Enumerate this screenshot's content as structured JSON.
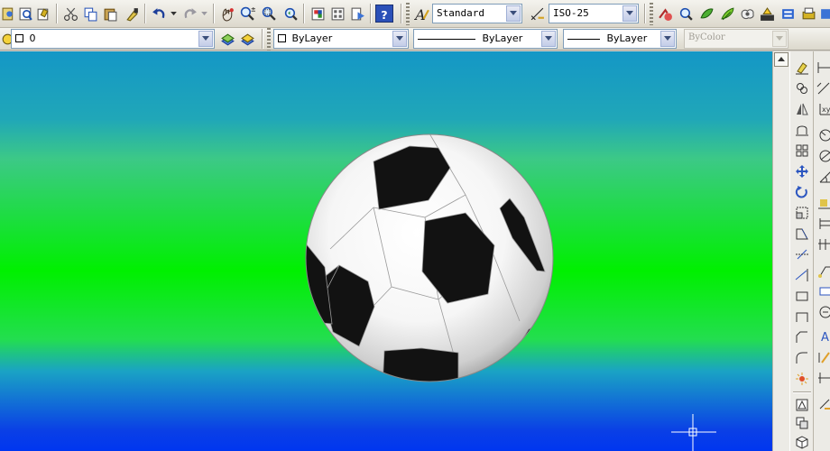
{
  "toolbar": {
    "text_style": {
      "value": "Standard"
    },
    "dim_style": {
      "value": "ISO-25"
    },
    "icons": [
      "design-center-icon",
      "tool-palettes-icon",
      "sheet-set-icon",
      "cut-icon",
      "copy-icon",
      "paste-icon",
      "match-properties-icon",
      "undo-icon",
      "undo-dropdown-icon",
      "redo-icon",
      "redo-dropdown-icon",
      "pan-icon",
      "zoom-realtime-icon",
      "zoom-window-icon",
      "zoom-previous-icon",
      "properties-icon",
      "design-center-2-icon",
      "tool-palettes-2-icon",
      "help-icon",
      "text-style-icon",
      "dim-style-icon",
      "render-lights-icon",
      "render-scene-icon",
      "materials-icon",
      "landscape-icon",
      "fog-icon",
      "render-icon",
      "statistics-icon"
    ]
  },
  "layers": {
    "current_layer": "0",
    "color": "ByLayer",
    "linetype": "ByLayer",
    "lineweight": "ByLayer",
    "plot_style": "ByColor"
  },
  "modify_toolbar": {
    "icons": [
      "erase-icon",
      "copy-object-icon",
      "mirror-icon",
      "offset-icon",
      "array-icon",
      "move-icon",
      "rotate-icon",
      "scale-icon",
      "stretch-icon",
      "trim-icon",
      "extend-icon",
      "break-icon",
      "join-icon",
      "chamfer-icon",
      "fillet-icon",
      "explode-icon"
    ]
  },
  "dimension_toolbar": {
    "icons": [
      "linear-dim-icon",
      "aligned-dim-icon",
      "ordinate-dim-icon",
      "radius-dim-icon",
      "diameter-dim-icon",
      "angular-dim-icon",
      "quick-dim-icon",
      "baseline-dim-icon",
      "continue-dim-icon",
      "leader-icon",
      "tolerance-icon",
      "center-mark-icon",
      "dim-edit-icon",
      "dim-text-edit-icon",
      "dim-update-icon",
      "dim-style-edit-icon"
    ]
  },
  "colors": {
    "accent_blue": "#0b3ad6",
    "canvas_top": "#1497c6",
    "canvas_mid": "#00f000",
    "canvas_bottom": "#0036f0"
  }
}
